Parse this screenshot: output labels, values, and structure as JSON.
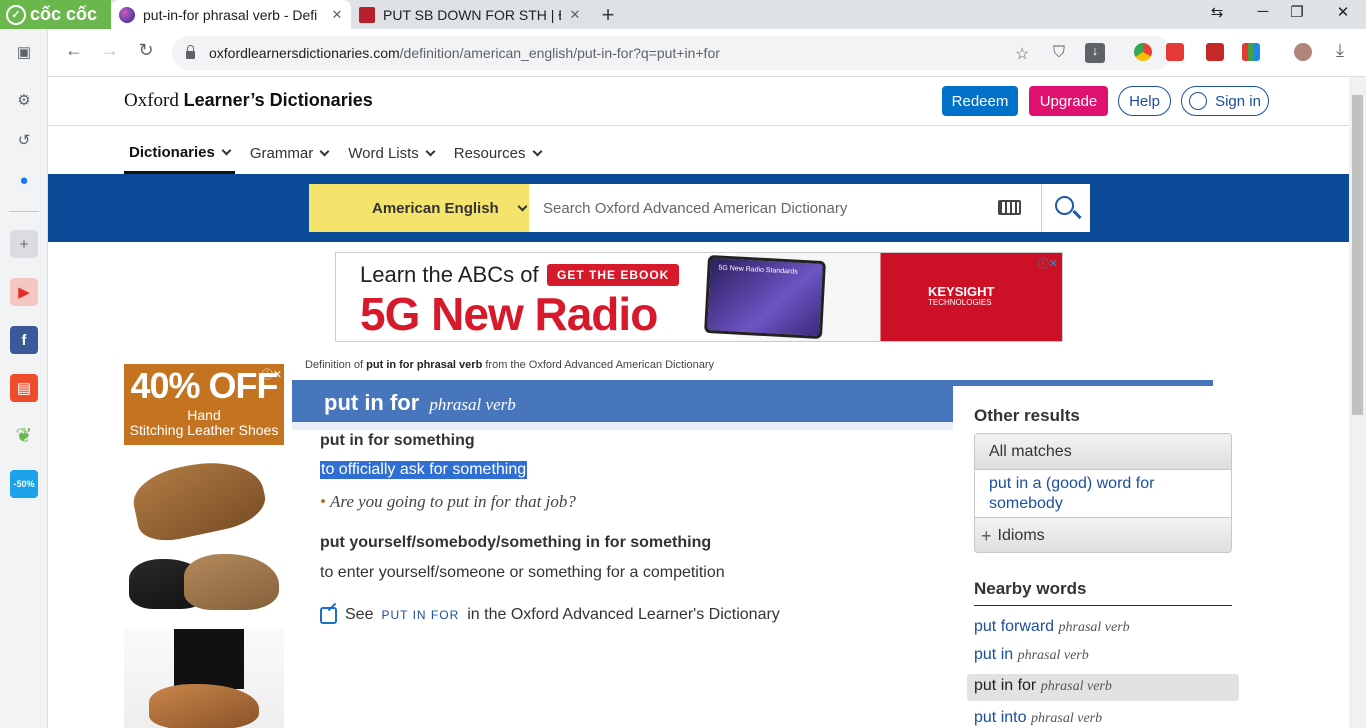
{
  "browser": {
    "brand": "cốc cốc",
    "tabs": [
      {
        "title": "put-in-for phrasal verb - Defi",
        "active": true
      },
      {
        "title": "PUT SB DOWN FOR STH | Định",
        "active": false
      }
    ],
    "url_host": "oxfordlearnersdictionaries.com",
    "url_path": "/definition/american_english/put-in-for?q=put+in+for"
  },
  "site": {
    "logo_regular": "Oxford",
    "logo_bold": "Learner’s Dictionaries",
    "buttons": {
      "redeem": "Redeem",
      "upgrade": "Upgrade",
      "help": "Help",
      "signin": "Sign in"
    },
    "nav": [
      "Dictionaries",
      "Grammar",
      "Word Lists",
      "Resources"
    ],
    "dictionary_select": "American English",
    "search_placeholder": "Search Oxford Advanced American Dictionary"
  },
  "ad_banner": {
    "line1": "Learn the ABCs of",
    "line2": "5G New Radio",
    "cta": "GET THE EBOOK",
    "tablet_text": "5G New Radio Standards",
    "brand": "KEYSIGHT",
    "brand_sub": "TECHNOLOGIES"
  },
  "side_ad": {
    "percent": "40% OFF",
    "desc1": "Hand",
    "desc2": "Stitching Leather Shoes"
  },
  "entry": {
    "definition_of_prefix": "Definition of",
    "definition_of_word": "put in for phrasal verb",
    "definition_of_suffix": "from the Oxford Advanced American Dictionary",
    "headword": "put in for",
    "pos": "phrasal verb",
    "senses": [
      {
        "head": "put in for something",
        "def": "to officially ask for something",
        "example": "Are you going to put in for that job?"
      },
      {
        "head": "put yourself/somebody/something in for something",
        "def": "to enter yourself/someone or something for a competition"
      }
    ],
    "see_prefix": "See",
    "see_link": "PUT IN FOR",
    "see_suffix": "in the Oxford Advanced Learner's Dictionary"
  },
  "other_results": {
    "title": "Other results",
    "all_matches": "All matches",
    "match": "put in a (good) word for somebody",
    "idioms": "Idioms"
  },
  "nearby": {
    "title": "Nearby words",
    "items": [
      {
        "word": "put forward",
        "pos": "phrasal verb"
      },
      {
        "word": "put in",
        "pos": "phrasal verb"
      },
      {
        "word": "put in for",
        "pos": "phrasal verb"
      },
      {
        "word": "put into",
        "pos": "phrasal verb"
      }
    ]
  },
  "colors": {
    "brand_blue": "#0a4a96",
    "entry_blue": "#4876bd",
    "redeem": "#0070c9",
    "upgrade": "#e0106e",
    "select_yellow": "#f5e46c"
  }
}
